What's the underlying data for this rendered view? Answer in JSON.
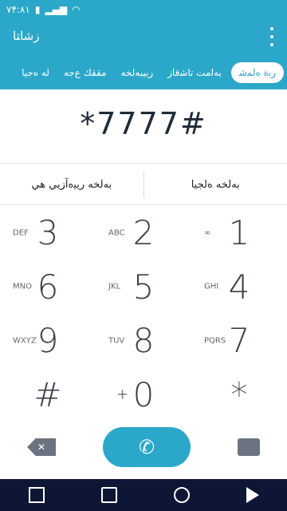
{
  "status_bar": {
    "time": "۷۴:۸۱",
    "icons": [
      "battery-icon",
      "signal-icon",
      "wifi-icon"
    ]
  },
  "app_bar": {
    "title": "ﺯﺷﺎﺘﺎ",
    "overflow_icon": "more-vert-icon"
  },
  "tabs": [
    {
      "label": "ﺭﺑﺓ ﻩﻟﻤﺷ",
      "active": true
    },
    {
      "label": "ﺑﻪﻟﻣﺖ ﺗﺎﺷﻗﺎﺯ",
      "active": false
    },
    {
      "label": "ﺯﺑﻴﺒﻪﻟﺨﻪ",
      "active": false
    },
    {
      "label": "ﻣﻘﻘﻚ ﻉﺟﻪ",
      "active": false
    },
    {
      "label": "ﻟﻪ ﻩﺟﻴﺎ",
      "active": false
    }
  ],
  "dialed_number": "*7777#",
  "call_options": {
    "left": "ﺑﻪﻟﺨﻪ ﺭﻳﻴﻩﺁﺯﻳﻲ ﻫﻲ",
    "right": "ﺑﻪﻟﺨﻪ ﻩﻟﺠﻴﺎ"
  },
  "keypad": [
    {
      "digit": "1",
      "letters": "∞"
    },
    {
      "digit": "2",
      "letters": "ABC"
    },
    {
      "digit": "3",
      "letters": "DEF"
    },
    {
      "digit": "4",
      "letters": "GHI"
    },
    {
      "digit": "5",
      "letters": "JKL"
    },
    {
      "digit": "6",
      "letters": "MNO"
    },
    {
      "digit": "7",
      "letters": "PQRS"
    },
    {
      "digit": "8",
      "letters": "TUV"
    },
    {
      "digit": "9",
      "letters": "WXYZ"
    },
    {
      "digit": "*",
      "letters": ""
    },
    {
      "digit": "0",
      "letters": "+"
    },
    {
      "digit": "#",
      "letters": ""
    }
  ],
  "bottom": {
    "delete_icon": "backspace-icon",
    "call_icon": "phone-icon",
    "message_icon": "message-icon"
  },
  "nav": {
    "back": "back-icon",
    "home": "home-icon",
    "recents": "recents-icon",
    "sim": "sim-icon"
  },
  "colors": {
    "primary": "#2ba7c9",
    "nav_bg": "#0e1635",
    "text_dark": "#1f2a36"
  }
}
